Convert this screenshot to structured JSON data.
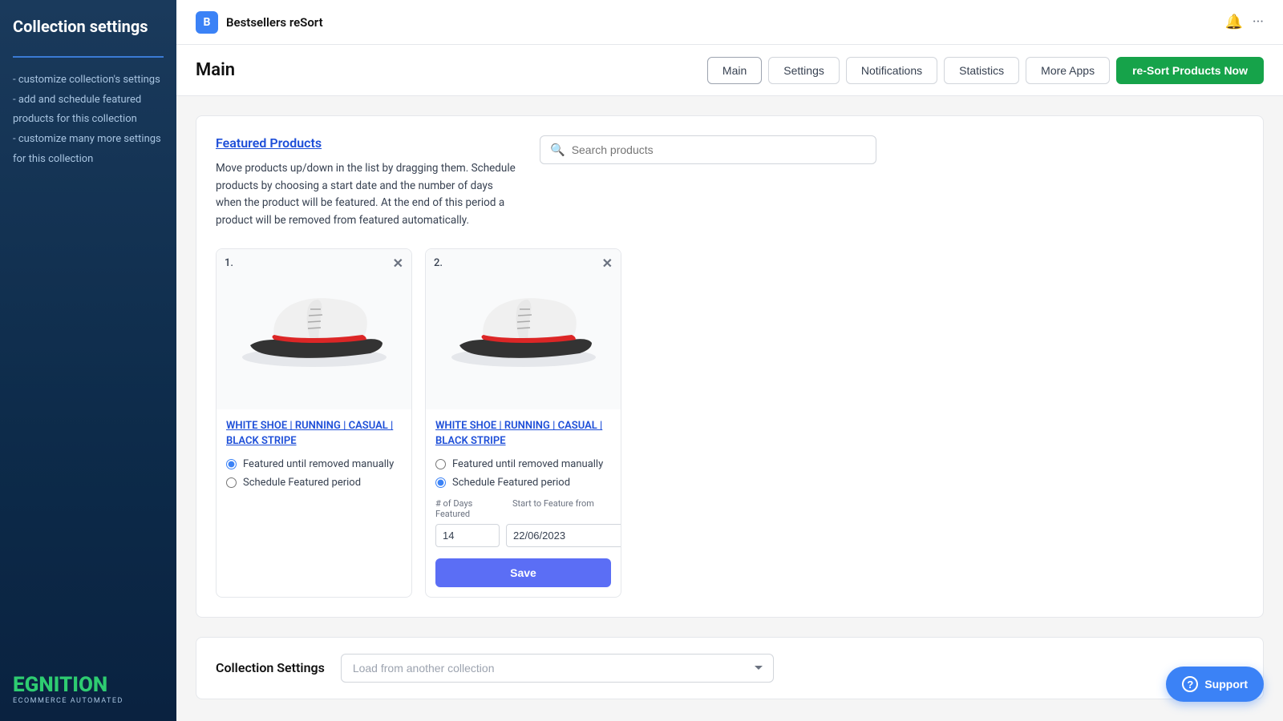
{
  "sidebar": {
    "title": "Collection settings",
    "nav": [
      "- customize collection's settings",
      "- add and schedule featured products for this collection",
      "- customize many more settings for this collection"
    ],
    "logo": {
      "brand": "EGNITION",
      "sub": "ECOMMERCE AUTOMATED"
    }
  },
  "topbar": {
    "app_name": "Bestsellers reSort",
    "app_icon": "B"
  },
  "header": {
    "page_title": "Main",
    "tabs": [
      {
        "label": "Main",
        "active": true
      },
      {
        "label": "Settings",
        "active": false
      },
      {
        "label": "Notifications",
        "active": false
      },
      {
        "label": "Statistics",
        "active": false
      },
      {
        "label": "More Apps",
        "active": false
      }
    ],
    "primary_button": "re-Sort Products Now"
  },
  "featured_products": {
    "section_title": "Featured Products",
    "description": "Move products up/down in the list by dragging them. Schedule products by choosing a start date and the number of days when the product will be featured. At the end of this period a product will be removed from featured automatically.",
    "search_placeholder": "Search products",
    "products": [
      {
        "number": "1.",
        "name": "WHITE SHOE | RUNNING | CASUAL | BLACK STRIPE",
        "radio_options": [
          {
            "label": "Featured until removed manually",
            "selected": true
          },
          {
            "label": "Schedule Featured period",
            "selected": false
          }
        ],
        "show_schedule": false
      },
      {
        "number": "2.",
        "name": "WHITE SHOE | RUNNING | CASUAL | BLACK STRIPE",
        "radio_options": [
          {
            "label": "Featured until removed manually",
            "selected": false
          },
          {
            "label": "Schedule Featured period",
            "selected": true
          }
        ],
        "show_schedule": true,
        "days_label": "# of Days Featured",
        "start_label": "Start to Feature from",
        "days_value": "14",
        "date_value": "22/06/2023"
      }
    ]
  },
  "collection_settings": {
    "label": "Collection Settings",
    "select_placeholder": "Load from another collection"
  },
  "support": {
    "label": "Support"
  }
}
